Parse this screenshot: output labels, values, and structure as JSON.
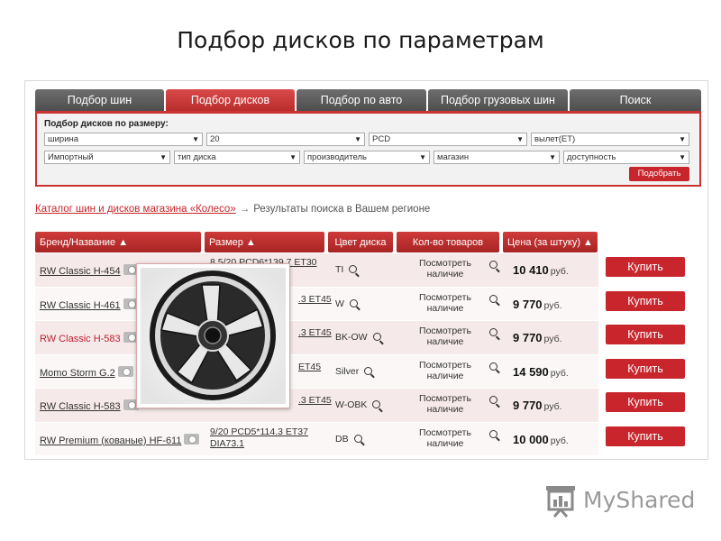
{
  "title": "Подбор дисков по параметрам",
  "tabs": [
    {
      "label": "Подбор шин",
      "active": false
    },
    {
      "label": "Подбор дисков",
      "active": true
    },
    {
      "label": "Подбор по авто",
      "active": false
    },
    {
      "label": "Подбор грузовых шин",
      "active": false
    },
    {
      "label": "Поиск",
      "active": false
    }
  ],
  "filter": {
    "label": "Подбор дисков по размеру:",
    "width": "ширина",
    "diameter": "20",
    "pcd": "PCD",
    "et": "вылет(ET)",
    "origin": "Импортный",
    "disk_type": "тип диска",
    "manufacturer": "производитель",
    "store": "магазин",
    "availability": "доступность",
    "button": "Подобрать"
  },
  "breadcrumb": {
    "link": "Каталог шин и дисков магазина «Колесо»",
    "arrow": "→",
    "current": "Результаты поиска в Вашем регионе"
  },
  "table": {
    "headers": {
      "brand": "Бренд/Название ▲",
      "size": "Размер ▲",
      "color": "Цвет диска",
      "qty": "Кол-во товаров",
      "price": "Цена (за штуку) ▲"
    },
    "rows": [
      {
        "brand": "RW Classic H-454",
        "size": "8.5/20 PCD6*139.7 ET30",
        "color": "TI",
        "qty": "Посмотреть наличие",
        "price": "10 410",
        "currency": "руб.",
        "buy": "Купить"
      },
      {
        "brand": "RW Classic H-461",
        "size": ".3 ET45",
        "color": "W",
        "qty": "Посмотреть наличие",
        "price": "9 770",
        "currency": "руб.",
        "buy": "Купить"
      },
      {
        "brand": "RW Classic H-583",
        "size": ".3 ET45",
        "color": "BK-OW",
        "qty": "Посмотреть наличие",
        "price": "9 770",
        "currency": "руб.",
        "buy": "Купить"
      },
      {
        "brand": "Momo Storm G.2",
        "size": "ET45",
        "color": "Silver",
        "qty": "Посмотреть наличие",
        "price": "14 590",
        "currency": "руб.",
        "buy": "Купить"
      },
      {
        "brand": "RW Classic H-583",
        "size": ".3 ET45",
        "color": "W-OBK",
        "qty": "Посмотреть наличие",
        "price": "9 770",
        "currency": "руб.",
        "buy": "Купить"
      },
      {
        "brand": "RW Premium (кованые) HF-611",
        "size": "9/20 PCD5*114.3 ET37 DIA73.1",
        "color": "DB",
        "qty": "Посмотреть наличие",
        "price": "10 000",
        "currency": "руб.",
        "buy": "Купить"
      }
    ]
  },
  "logo": {
    "text": "MyShared"
  },
  "colors": {
    "accent": "#c8262c",
    "tab": "#5a5a5a"
  }
}
